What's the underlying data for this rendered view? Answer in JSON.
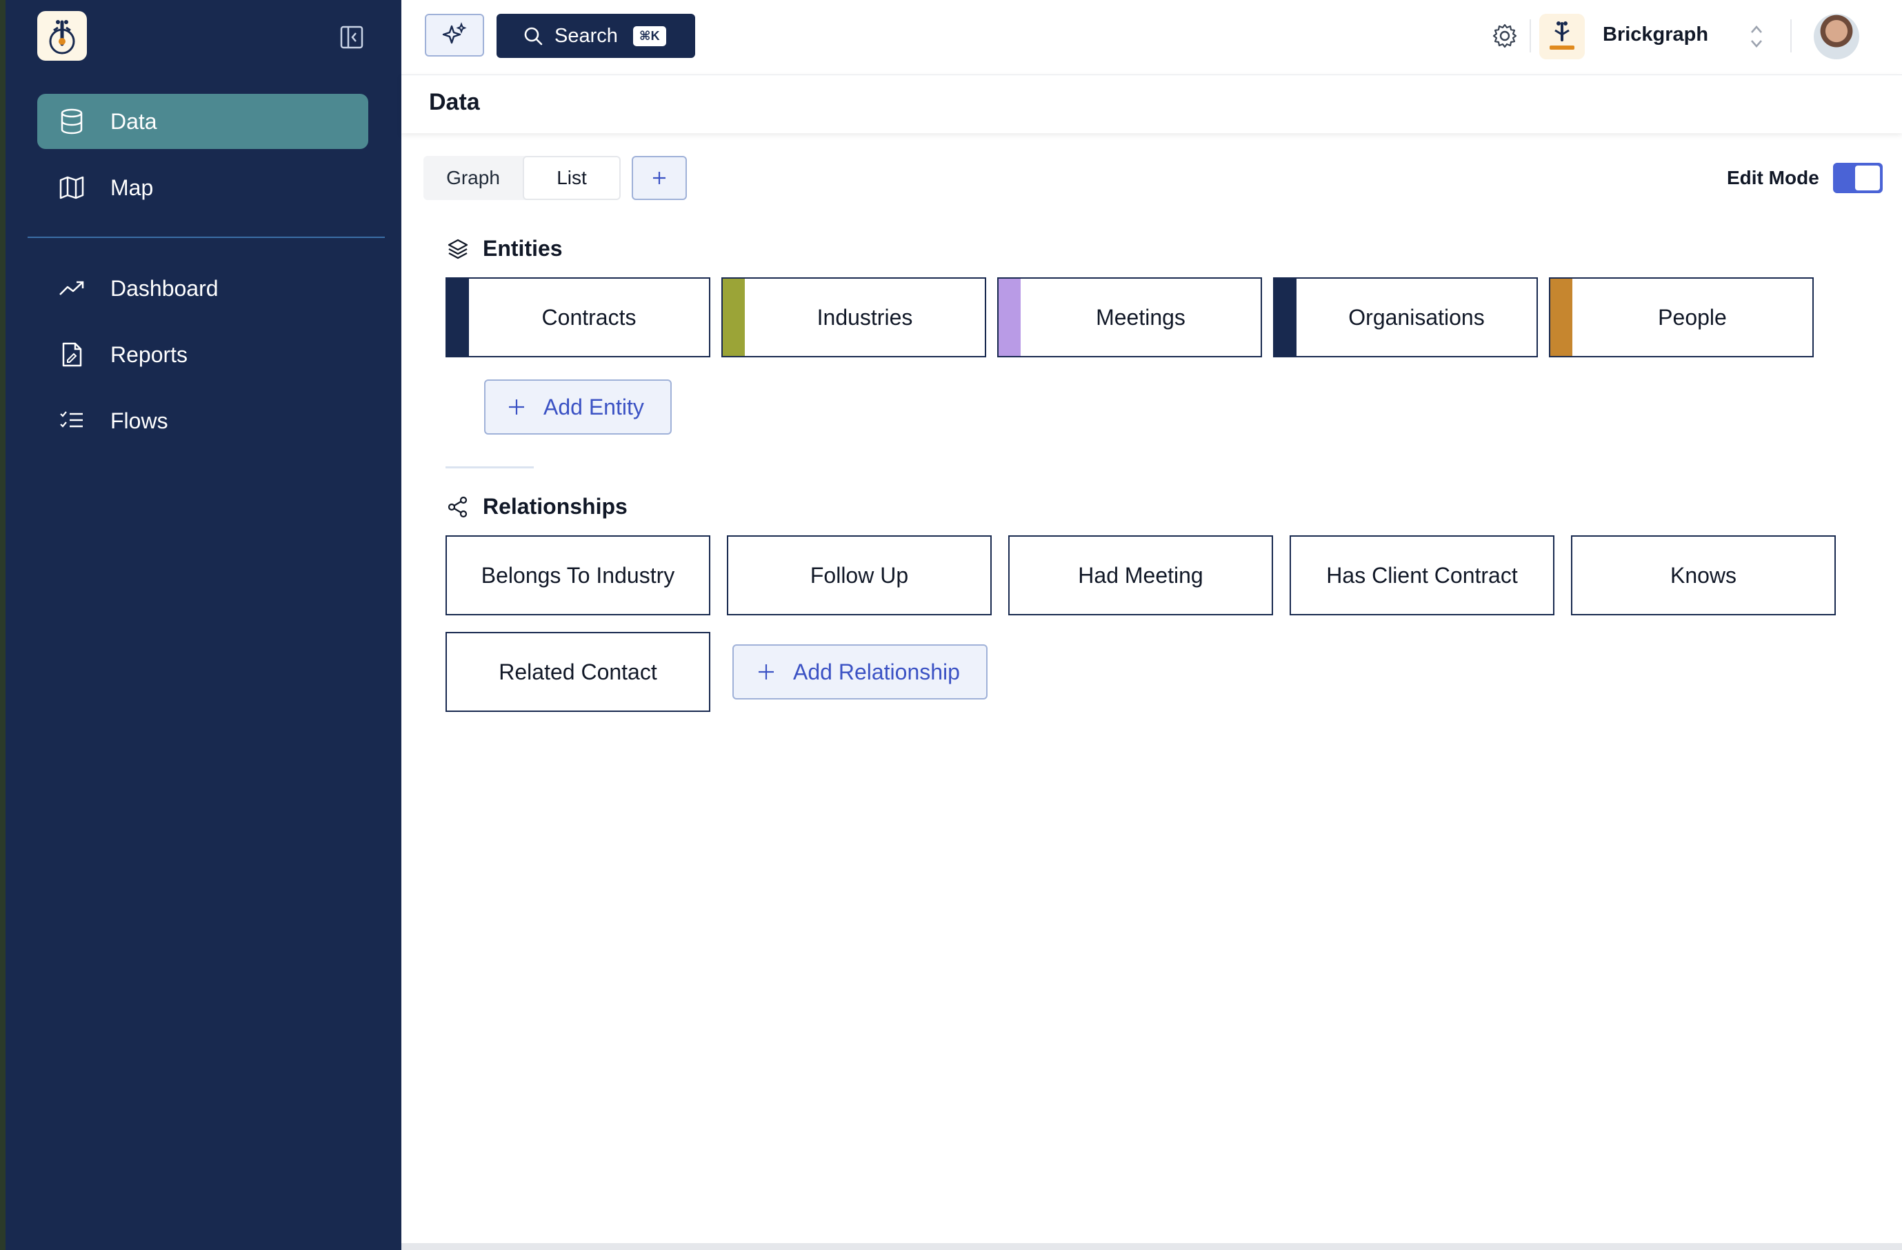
{
  "sidebar": {
    "items": [
      {
        "label": "Data",
        "icon": "database-icon",
        "active": true
      },
      {
        "label": "Map",
        "icon": "map-icon"
      },
      {
        "label": "Dashboard",
        "icon": "trending-up-icon"
      },
      {
        "label": "Reports",
        "icon": "report-icon"
      },
      {
        "label": "Flows",
        "icon": "checklist-icon"
      }
    ]
  },
  "topbar": {
    "search_label": "Search",
    "search_shortcut": "⌘K",
    "org_name": "Brickgraph"
  },
  "page": {
    "title": "Data",
    "tabs": [
      {
        "label": "Graph"
      },
      {
        "label": "List"
      }
    ],
    "edit_mode_label": "Edit Mode",
    "edit_mode_on": true
  },
  "entities": {
    "title": "Entities",
    "items": [
      {
        "label": "Contracts",
        "color": "#18294f"
      },
      {
        "label": "Industries",
        "color": "#9ba437"
      },
      {
        "label": "Meetings",
        "color": "#b99be6"
      },
      {
        "label": "Organisations",
        "color": "#18294f"
      },
      {
        "label": "People",
        "color": "#c6862f"
      }
    ],
    "add_label": "Add Entity"
  },
  "relationships": {
    "title": "Relationships",
    "items": [
      {
        "label": "Belongs To Industry"
      },
      {
        "label": "Follow Up"
      },
      {
        "label": "Had Meeting"
      },
      {
        "label": "Has Client Contract"
      },
      {
        "label": "Knows"
      },
      {
        "label": "Related Contact"
      }
    ],
    "add_label": "Add Relationship"
  },
  "colors": {
    "sidebar_bg": "#18294f",
    "active_nav": "#4d8991",
    "accent": "#4a63d6",
    "accent_text": "#3b52c4"
  }
}
